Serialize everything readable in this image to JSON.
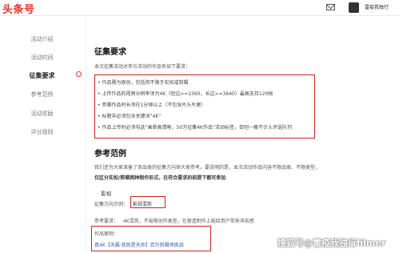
{
  "header": {
    "logo": "头条号",
    "username": "雷疫我独行",
    "username_sub": "…"
  },
  "sidebar": {
    "items": [
      {
        "label": "活动介绍",
        "active": false
      },
      {
        "label": "活动时间",
        "active": false
      },
      {
        "label": "征集要求",
        "active": true
      },
      {
        "label": "参考范例",
        "active": false
      },
      {
        "label": "活动奖励",
        "active": false
      },
      {
        "label": "评分规则",
        "active": false
      }
    ]
  },
  "main": {
    "section1": {
      "title": "征集要求",
      "intro": "本次征集活动对参与活动的作品有如下要求：",
      "bullets": [
        "• 作品需为原创，包括但不限于实拍或剪辑",
        "• 上传作品的视频分辨率须为4K（短边>=1560，长边>=3640）最高支持120帧",
        "• 参赛作品时长须在1分钟以上（不包含片头片尾）",
        "• 标题中必须包含关键词“4K”",
        "• 作品上传时必须勾选“画质高清晰，50万征集4K作品”活动标签，否则一概不计入评选队列"
      ]
    },
    "section2": {
      "title": "参考范例",
      "para1": "我们还为大家准备了各品类的征集方向供大家参考。要说明的是，本次活动作品内容不限品类、不限类型，",
      "para2": "仅区分实拍/剪辑两种制作形式，在符合要求的前提下都可参加",
      "category": "· 影视",
      "direction_label": "征集方向示例：",
      "direction_tag": "影视混剪",
      "ref_label": "参考要求：",
      "ref_text": "4K混剪，不局限创作类型，在营造制作上能给用户带来冲击感",
      "example_label": "作品案例：",
      "example_link": "真4K【天霸·我就是天命】百万剪辑师挑战"
    }
  },
  "watermark": "搜狐号@雷疫我独行filmer",
  "colors": {
    "brand_red": "#e8322a",
    "highlight_red": "#d0221b",
    "link_blue": "#2a5db0"
  }
}
